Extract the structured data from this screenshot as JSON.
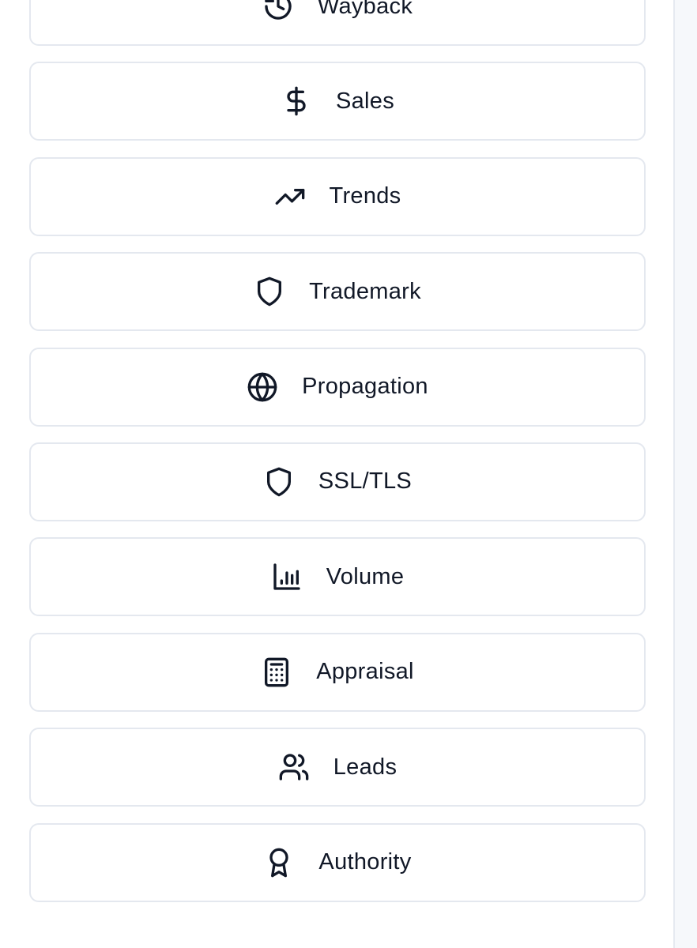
{
  "menu": {
    "items": [
      {
        "label": "Wayback",
        "icon": "history-clock-icon"
      },
      {
        "label": "Sales",
        "icon": "dollar-sign-icon"
      },
      {
        "label": "Trends",
        "icon": "trending-up-icon"
      },
      {
        "label": "Trademark",
        "icon": "shield-icon"
      },
      {
        "label": "Propagation",
        "icon": "globe-icon"
      },
      {
        "label": "SSL/TLS",
        "icon": "shield-icon"
      },
      {
        "label": "Volume",
        "icon": "bar-chart-icon"
      },
      {
        "label": "Appraisal",
        "icon": "calculator-icon"
      },
      {
        "label": "Leads",
        "icon": "users-icon"
      },
      {
        "label": "Authority",
        "icon": "award-icon"
      }
    ]
  },
  "colors": {
    "text": "#111827",
    "border": "#e4e8ef",
    "background": "#ffffff",
    "side_strip": "#f6f8fb"
  }
}
